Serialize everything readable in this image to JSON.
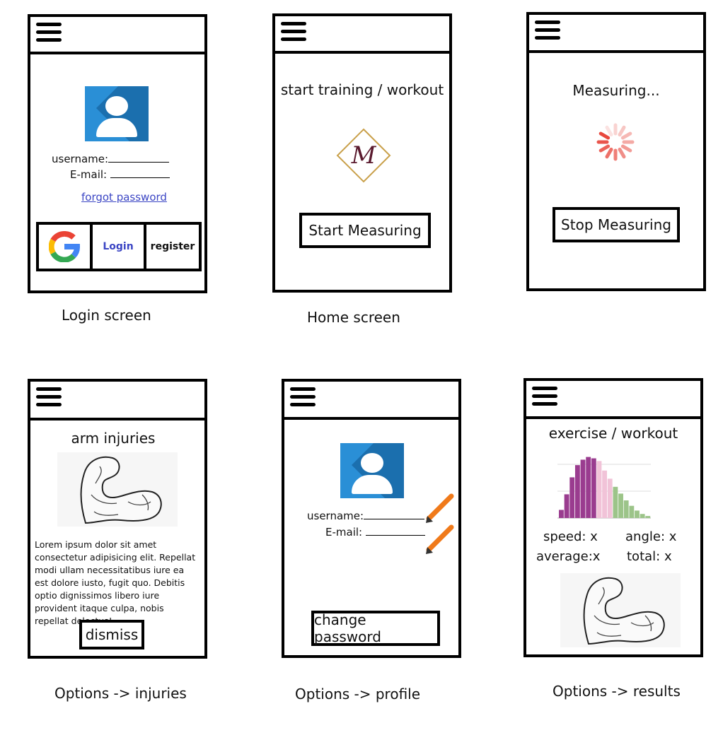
{
  "login": {
    "username_label": "username:",
    "email_label": "E-mail:",
    "forgot_link": "forgot password",
    "login_button": "Login",
    "register_button": "register",
    "caption": "Login screen"
  },
  "home": {
    "title": "start training / workout",
    "logo_letter": "M",
    "start_button": "Start Measuring",
    "caption": "Home screen"
  },
  "measuring": {
    "title": "Measuring...",
    "stop_button": "Stop Measuring"
  },
  "injuries": {
    "title": "arm injuries",
    "text": "Lorem ipsum dolor sit amet consectetur adipisicing elit. Repellat modi ullam necessitatibus iure ea est dolore iusto, fugit quo. Debitis optio dignissimos libero iure provident itaque culpa, nobis repellat delectus!",
    "dismiss_button": "dismiss",
    "caption": "Options -> injuries"
  },
  "profile": {
    "username_label": "username:",
    "email_label": "E-mail:",
    "change_password_button": "change password",
    "caption": "Options -> profile"
  },
  "results": {
    "title": "exercise / workout",
    "speed": "speed:  x",
    "angle": "angle: x",
    "average": "average:x",
    "total": "total:  x",
    "caption": "Options -> results"
  },
  "colors": {
    "avatar_blue": "#2a8fd6",
    "link_blue": "#3b45c4",
    "spinner_red": "#e8473d",
    "logo_gold": "#c9a04a",
    "logo_maroon": "#5a1a2e",
    "pencil_orange": "#f07a1a"
  },
  "chart_data": {
    "type": "bar",
    "series": [
      {
        "name": "",
        "color": "#9a3c8f",
        "values": [
          12,
          35,
          60,
          78,
          86,
          90,
          88
        ]
      },
      {
        "name": "",
        "color": "#f1c3d8",
        "values": [
          84,
          70,
          58
        ]
      },
      {
        "name": "",
        "color": "#9cc489",
        "values": [
          46,
          36,
          26,
          18,
          11,
          6,
          3
        ]
      }
    ]
  }
}
